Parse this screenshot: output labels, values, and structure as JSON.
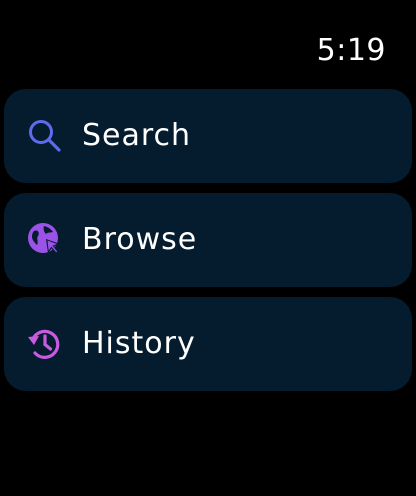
{
  "status": {
    "time": "5:19"
  },
  "menu": {
    "items": [
      {
        "label": "Search",
        "icon": "magnifier-icon",
        "color": "#5d6bf0"
      },
      {
        "label": "Browse",
        "icon": "globe-cursor-icon",
        "color": "#9b52e6"
      },
      {
        "label": "History",
        "icon": "clock-history-icon",
        "color": "#c95be0"
      }
    ]
  }
}
